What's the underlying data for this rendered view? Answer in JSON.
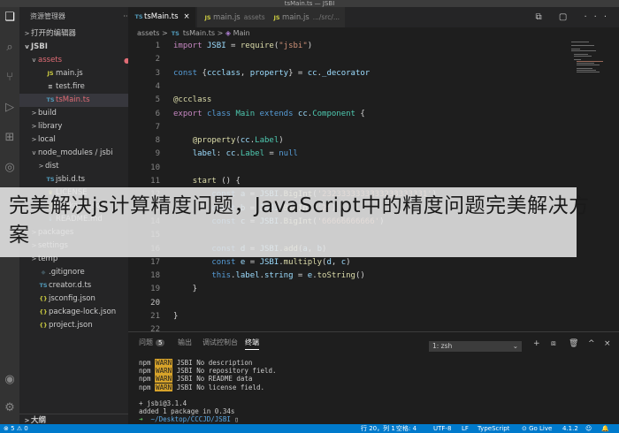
{
  "window": {
    "title": "tsMain.ts — JSBI"
  },
  "activity_icons": [
    "files-icon",
    "search-icon",
    "source-control-icon",
    "run-debug-icon",
    "extensions-icon",
    "remote-icon"
  ],
  "activity_bottom_icons": [
    "account-icon",
    "settings-gear-icon"
  ],
  "sidebar": {
    "title": "资源管理器",
    "more": "···",
    "open_editors": "打开的编辑器",
    "project": "JSBI",
    "tree": [
      {
        "indent": 1,
        "chev": "v",
        "icon": "",
        "label": "assets",
        "red": true,
        "badge": "●",
        "sel": false
      },
      {
        "indent": 2,
        "chev": "",
        "icon": "JS",
        "label": "main.js",
        "red": false,
        "badge": "",
        "sel": false
      },
      {
        "indent": 2,
        "chev": "",
        "icon": "≡",
        "label": "test.fire",
        "red": false,
        "badge": "",
        "sel": false
      },
      {
        "indent": 2,
        "chev": "",
        "icon": "TS",
        "label": "tsMain.ts",
        "red": true,
        "badge": "5",
        "sel": true
      },
      {
        "indent": 1,
        "chev": ">",
        "icon": "",
        "label": "build",
        "red": false,
        "badge": "",
        "sel": false
      },
      {
        "indent": 1,
        "chev": ">",
        "icon": "",
        "label": "library",
        "red": false,
        "badge": "",
        "sel": false
      },
      {
        "indent": 1,
        "chev": ">",
        "icon": "",
        "label": "local",
        "red": false,
        "badge": "",
        "sel": false
      },
      {
        "indent": 1,
        "chev": "v",
        "icon": "",
        "label": "node_modules / jsbi",
        "red": false,
        "badge": "",
        "sel": false
      },
      {
        "indent": 2,
        "chev": ">",
        "icon": "",
        "label": "dist",
        "red": false,
        "badge": "",
        "sel": false
      },
      {
        "indent": 2,
        "chev": "",
        "icon": "TS",
        "label": "jsbi.d.ts",
        "red": false,
        "badge": "",
        "sel": false
      },
      {
        "indent": 2,
        "chev": "",
        "icon": "♛",
        "label": "LICENSE",
        "red": false,
        "badge": "",
        "sel": false
      },
      {
        "indent": 2,
        "chev": "",
        "icon": "{}",
        "label": "package.json",
        "red": false,
        "badge": "",
        "sel": false
      },
      {
        "indent": 2,
        "chev": "",
        "icon": "↓",
        "label": "README.md",
        "red": false,
        "badge": "",
        "sel": false
      },
      {
        "indent": 1,
        "chev": ">",
        "icon": "",
        "label": "packages",
        "red": false,
        "badge": "",
        "sel": false
      },
      {
        "indent": 1,
        "chev": ">",
        "icon": "",
        "label": "settings",
        "red": false,
        "badge": "",
        "sel": false
      },
      {
        "indent": 1,
        "chev": ">",
        "icon": "",
        "label": "temp",
        "red": false,
        "badge": "",
        "sel": false
      },
      {
        "indent": 1,
        "chev": "",
        "icon": "◆",
        "label": ".gitignore",
        "red": false,
        "badge": "",
        "sel": false
      },
      {
        "indent": 1,
        "chev": "",
        "icon": "TS",
        "label": "creator.d.ts",
        "red": false,
        "badge": "",
        "sel": false
      },
      {
        "indent": 1,
        "chev": "",
        "icon": "{}",
        "label": "jsconfig.json",
        "red": false,
        "badge": "",
        "sel": false
      },
      {
        "indent": 1,
        "chev": "",
        "icon": "{}",
        "label": "package-lock.json",
        "red": false,
        "badge": "",
        "sel": false
      },
      {
        "indent": 1,
        "chev": "",
        "icon": "{}",
        "label": "project.json",
        "red": false,
        "badge": "",
        "sel": false
      }
    ],
    "outline": "大纲"
  },
  "tabs": [
    {
      "icon": "TS",
      "label": "tsMain.ts",
      "sub": "",
      "close": "×",
      "active": true
    },
    {
      "icon": "JS",
      "label": "main.js",
      "sub": "assets",
      "close": "",
      "active": false
    },
    {
      "icon": "JS",
      "label": "main.js",
      "sub": ".../src/...",
      "close": "",
      "active": false
    }
  ],
  "tab_actions": "⧉ ▢ ···",
  "breadcrumb": {
    "folder": "assets",
    "sep": ">",
    "file_icon": "TS",
    "file": "tsMain.ts",
    "symbol_icon": "◈",
    "symbol": "Main"
  },
  "editor": {
    "current_line": 20,
    "lines": [
      {
        "n": "1",
        "html": "<span class='kw'>import</span> <span class='var'>JSBI</span> = <span class='fn'>require</span>(<span class='str'>\"jsbi\"</span>)"
      },
      {
        "n": "2",
        "html": ""
      },
      {
        "n": "3",
        "html": "<span class='kw2'>const</span> {<span class='var'>ccclass</span>, <span class='var'>property</span>} = <span class='var'>cc</span>.<span class='var'>_decorator</span>"
      },
      {
        "n": "4",
        "html": ""
      },
      {
        "n": "5",
        "html": "<span class='dec'>@ccclass</span>"
      },
      {
        "n": "6",
        "html": "<span class='kw'>export</span> <span class='kw2'>class</span> <span class='cls'>Main</span> <span class='kw2'>extends</span> <span class='var'>cc</span>.<span class='cls'>Component</span> {"
      },
      {
        "n": "7",
        "html": ""
      },
      {
        "n": "8",
        "html": "    <span class='dec'>@property</span>(<span class='var'>cc</span>.<span class='cls'>Label</span>)"
      },
      {
        "n": "9",
        "html": "    <span class='var'>label</span>: <span class='var'>cc</span>.<span class='cls'>Label</span> = <span class='kw2'>null</span>"
      },
      {
        "n": "10",
        "html": ""
      },
      {
        "n": "11",
        "html": "    <span class='fn'>start</span> () {"
      },
      {
        "n": "12",
        "html": "        <span class='kw2'>const</span> <span class='var'>a</span> = <span class='var'>JSBI</span>.<span class='fn'>BigInt</span>(<span class='str'>'2323333333333233333331'</span>)"
      },
      {
        "n": "13",
        "html": "        <span class='kw2'>const</span> <span class='var'>b</span> = <span class='var'>JSBI</span>.<span class='fn'>BigInt</span>(<span class='str'>'2'</span>)"
      },
      {
        "n": "14",
        "html": "        <span class='kw2'>const</span> <span class='var'>c</span> = <span class='var'>JSBI</span>.<span class='fn'>BigInt</span>(<span class='str'>'66666666666'</span>)"
      },
      {
        "n": "15",
        "html": ""
      },
      {
        "n": "16",
        "html": "        <span class='kw2'>const</span> <span class='var'>d</span> = <span class='var'>JSBI</span>.<span class='fn'>add</span>(<span class='var'>a</span>, <span class='var'>b</span>)"
      },
      {
        "n": "17",
        "html": "        <span class='kw2'>const</span> <span class='var'>e</span> = <span class='var'>JSBI</span>.<span class='fn'>multiply</span>(<span class='var'>d</span>, <span class='var'>c</span>)"
      },
      {
        "n": "18",
        "html": "        <span class='kw2'>this</span>.<span class='var'>label</span>.<span class='var'>string</span> = <span class='var'>e</span>.<span class='fn'>toString</span>()"
      },
      {
        "n": "19",
        "html": "    }"
      },
      {
        "n": "20",
        "html": ""
      },
      {
        "n": "21",
        "html": "}"
      },
      {
        "n": "22",
        "html": ""
      }
    ]
  },
  "panel": {
    "tabs": [
      {
        "label": "问题",
        "badge": "5",
        "active": false
      },
      {
        "label": "输出",
        "badge": "",
        "active": false
      },
      {
        "label": "调试控制台",
        "badge": "",
        "active": false
      },
      {
        "label": "终端",
        "badge": "",
        "active": true
      }
    ],
    "terminal_select": "1: zsh",
    "actions": [
      "+",
      "⧈",
      "🗑",
      "^",
      "×"
    ],
    "terminal_lines": [
      "<span>npm </span><span class='warn'>WARN</span> JSBI No description",
      "<span>npm </span><span class='warn'>WARN</span> JSBI No repository field.",
      "<span>npm </span><span class='warn'>WARN</span> JSBI No README data",
      "<span>npm </span><span class='warn'>WARN</span> JSBI No license field.",
      "",
      "+ jsbi@3.1.4",
      "added 1 package in 0.34s",
      "<span class='green'>➜</span>  <span class='blue'>~/Desktop/CCCJD/JSBI</span> ▯"
    ]
  },
  "statusbar": {
    "left": "⊗ 5  ⚠ 0",
    "position": "行 20，列 1",
    "spaces": "空格: 4",
    "encoding": "UTF-8",
    "eol": "LF",
    "language": "TypeScript",
    "golive": "⊙ Go Live",
    "version": "4.1.2",
    "feedback": "☺",
    "bell": "🔔"
  },
  "overlay": {
    "text": "完美解决js计算精度问题，JavaScript中的精度问题完美解决方案"
  }
}
